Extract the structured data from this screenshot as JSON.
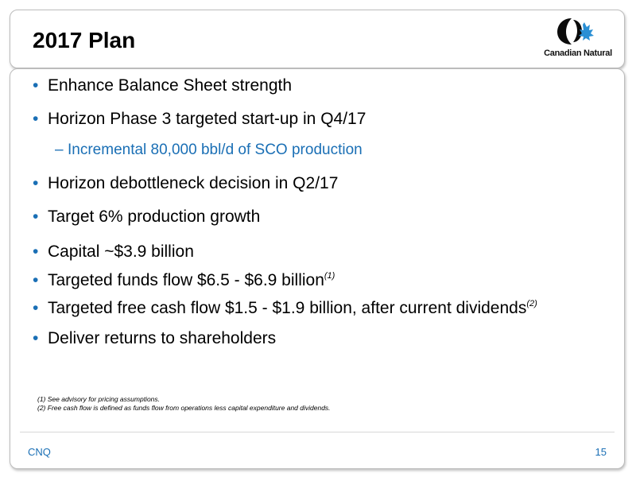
{
  "title": "2017 Plan",
  "logo": {
    "text": "Canadian Natural",
    "icon": "canadian-natural-logo-icon",
    "colors": {
      "dark": "#0b0b0b",
      "blue": "#2a8fd4"
    }
  },
  "bullets": [
    {
      "text": "Enhance Balance Sheet strength",
      "note": ""
    },
    {
      "text": "Horizon Phase 3 targeted start-up in Q4/17",
      "note": ""
    },
    {
      "text": "Horizon debottleneck decision in Q2/17",
      "note": ""
    },
    {
      "text": "Target 6% production growth",
      "note": ""
    },
    {
      "text": "Capital ~$3.9 billion",
      "note": ""
    },
    {
      "text": "Targeted funds flow $6.5 - $6.9 billion",
      "note": "(1)"
    },
    {
      "text": "Targeted free cash flow $1.5 - $1.9 billion, after current dividends",
      "note": "(2)"
    },
    {
      "text": "Deliver returns to shareholders",
      "note": ""
    }
  ],
  "sub_bullet": {
    "dash": "–",
    "text": "Incremental 80,000 bbl/d of SCO production"
  },
  "bullet_symbol": "•",
  "footnotes": [
    "(1) See advisory for pricing assumptions.",
    "(2) Free cash flow is defined as funds flow from operations less capital expenditure and dividends."
  ],
  "footer": {
    "left": "CNQ",
    "page_number": "15"
  },
  "colors": {
    "accent": "#1a6fb5",
    "text": "#000000",
    "border": "#bdbdbd"
  }
}
